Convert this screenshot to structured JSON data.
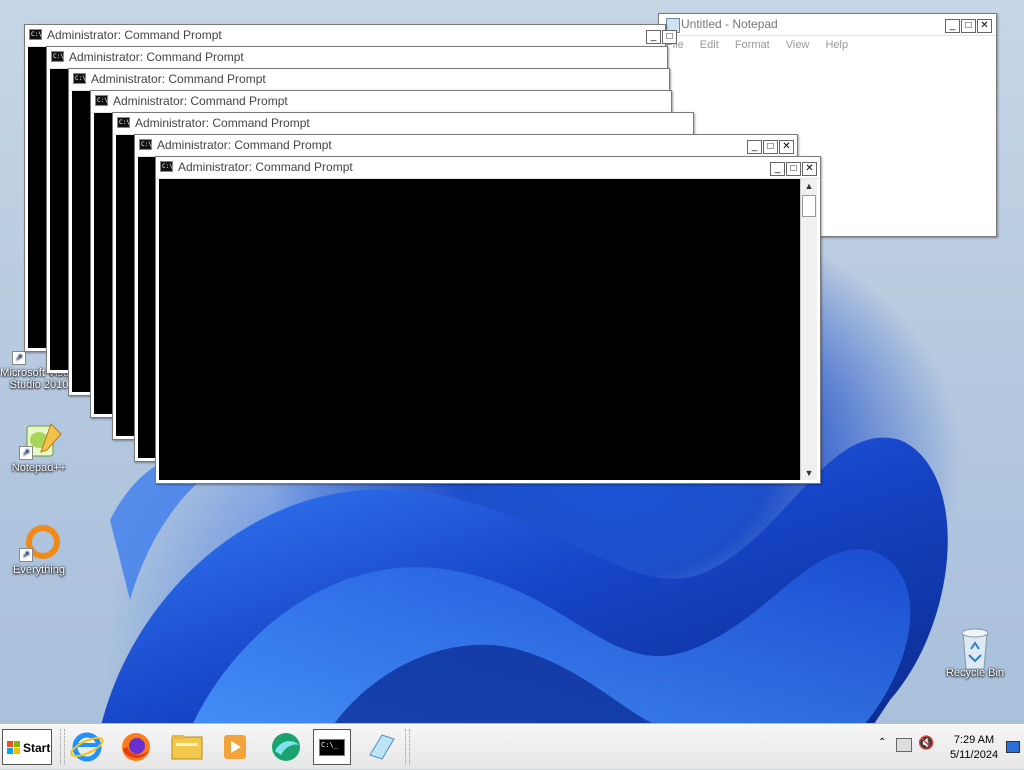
{
  "desktop": {
    "icons": [
      {
        "label": "Microsoft Visual Studio 2010",
        "label1": "Microsoft Visual",
        "label2": "Studio 2010"
      },
      {
        "label": "Notepad++"
      },
      {
        "label": "Everything"
      },
      {
        "label": "Recycle Bin"
      }
    ]
  },
  "cmd_windows": [
    {
      "title": "Administrator:  Command Prompt"
    },
    {
      "title": "Administrator:  Command Prompt"
    },
    {
      "title": "Administrator:  Command Prompt"
    },
    {
      "title": "Administrator:  Command Prompt"
    },
    {
      "title": "Administrator:  Command Prompt"
    },
    {
      "title": "Administrator:  Command Prompt"
    },
    {
      "title": "Administrator:  Command Prompt"
    }
  ],
  "cmd_icon_text": "C:\\.",
  "notepad": {
    "title": "Untitled - Notepad",
    "menu": [
      "File",
      "Edit",
      "Format",
      "View",
      "Help"
    ]
  },
  "window_controls": {
    "minimize": "_",
    "maximize": "□",
    "close": "✕"
  },
  "taskbar": {
    "start_label": "Start",
    "pinned": [
      "internet-explorer",
      "firefox",
      "file-explorer",
      "media-player",
      "browser-globe",
      "command-prompt",
      "notepad"
    ],
    "cmd_task_text": "C:\\_",
    "clock": {
      "time": "7:29 AM",
      "date": "5/11/2024"
    }
  },
  "colors": {
    "accent": "#1a56d8",
    "console_bg": "#000000",
    "taskbar": "#ececec"
  }
}
